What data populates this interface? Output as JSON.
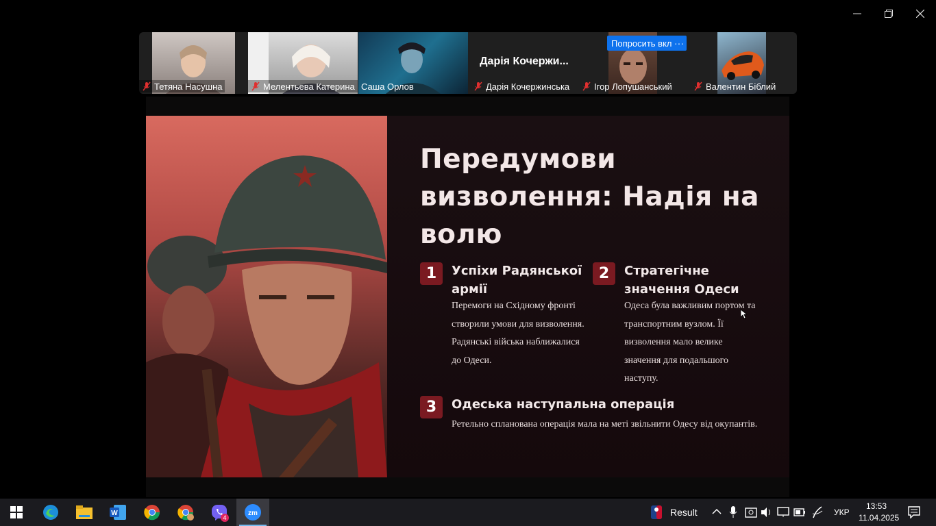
{
  "participants": [
    {
      "name": "Тетяна Насушна",
      "muted": true
    },
    {
      "name": "Мелентьева Катерина",
      "muted": true
    },
    {
      "name": "Саша Орлов",
      "muted": false,
      "active": true
    },
    {
      "name": "Дарія Кочержинська",
      "display_name": "Дарія  Кочержи...",
      "muted": true
    },
    {
      "name": "Ігор Лопушанський",
      "muted": true
    },
    {
      "name": "Валентин Біблий",
      "muted": true
    }
  ],
  "ask_button_label": "Попросить вкл",
  "more_button_label": "···",
  "slide": {
    "title": "Передумови визволення: Надія на волю",
    "items": [
      {
        "number": "1",
        "title": "Успіхи Радянської армії",
        "text": "Перемоги на Східному фронті створили умови для визволення. Радянські війська наближалися до Одеси."
      },
      {
        "number": "2",
        "title": "Стратегічне значення Одеси",
        "text": "Одеса була важливим портом та транспортним вузлом. Її визволення мало велике значення для подальшого наступу."
      },
      {
        "number": "3",
        "title": "Одеська наступальна операція",
        "text": "Ретельно спланована операція мала на меті звільнити Одесу від окупантів."
      }
    ]
  },
  "taskbar": {
    "apps": [
      "start-icon",
      "edge-icon",
      "file-explorer-icon",
      "word-icon",
      "chrome-icon",
      "chrome-profile-icon",
      "viber-icon",
      "zoom-icon"
    ],
    "viber_badge": "4",
    "result_label": "Result",
    "language": "УКР",
    "time": "13:53",
    "date": "11.04.2025"
  },
  "colors": {
    "accent_active_tile": "#2ed3a6",
    "zoom_blue": "#0e72ed",
    "number_box": "#7a1a21"
  }
}
